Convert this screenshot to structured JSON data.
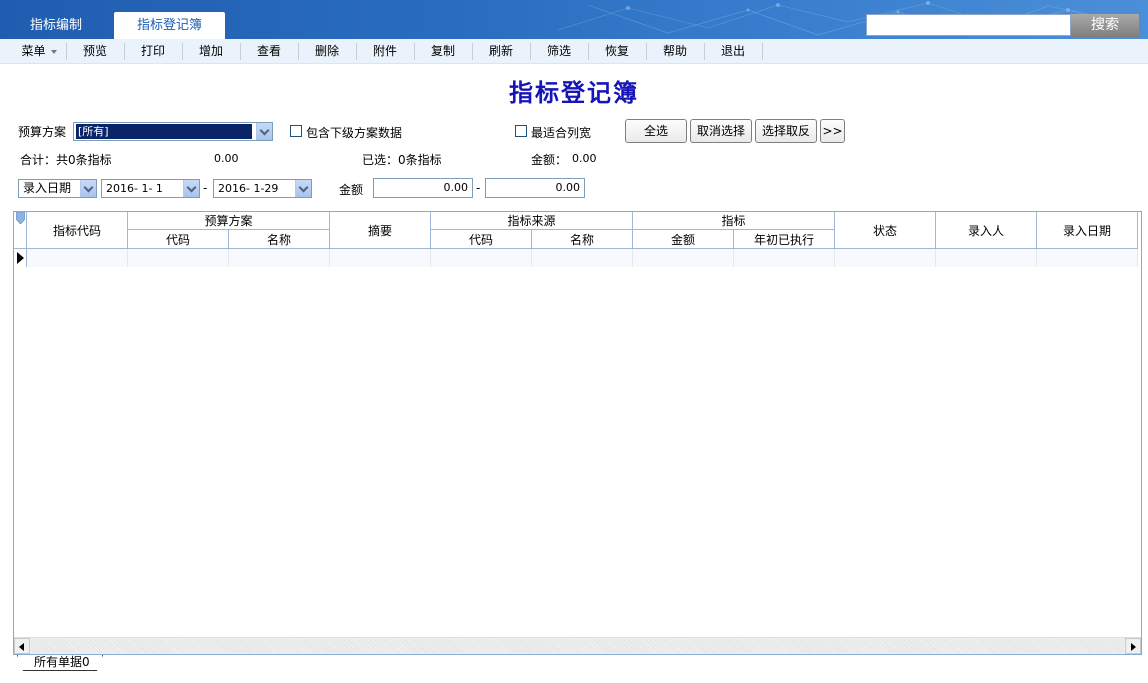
{
  "tabs": [
    {
      "label": "指标编制",
      "active": false
    },
    {
      "label": "指标登记簿",
      "active": true
    }
  ],
  "search": {
    "value": "",
    "button": "搜索"
  },
  "toolbar": [
    "菜单",
    "预览",
    "打印",
    "增加",
    "查看",
    "删除",
    "附件",
    "复制",
    "刷新",
    "筛选",
    "恢复",
    "帮助",
    "退出"
  ],
  "title": "指标登记簿",
  "filters": {
    "budget_plan_label": "预算方案",
    "budget_plan_value": "[所有]",
    "include_sub_label": "包含下级方案数据",
    "best_fit_label": "最适合列宽",
    "select_all": "全选",
    "cancel_select": "取消选择",
    "invert_select": "选择取反",
    "more": ">>"
  },
  "summary": {
    "total": "合计：共0条指标",
    "total_amount": "0.00",
    "selected": "已选：0条指标",
    "amount_label": "金额：",
    "amount_value": "0.00"
  },
  "date_filter": {
    "field": "录入日期",
    "from": "2016- 1- 1",
    "sep": "-",
    "to": "2016- 1-29",
    "amount_label": "金额",
    "amount_from": "0.00",
    "amount_to": "0.00"
  },
  "grid": {
    "headers": {
      "code": "指标代码",
      "budget_plan": "预算方案",
      "bp_code": "代码",
      "bp_name": "名称",
      "summary": "摘要",
      "source": "指标来源",
      "src_code": "代码",
      "src_name": "名称",
      "indicator": "指标",
      "amount": "金额",
      "executed": "年初已执行",
      "status": "状态",
      "entered_by": "录入人",
      "entry_date": "录入日期"
    }
  },
  "sheet_tab": "所有单据0"
}
